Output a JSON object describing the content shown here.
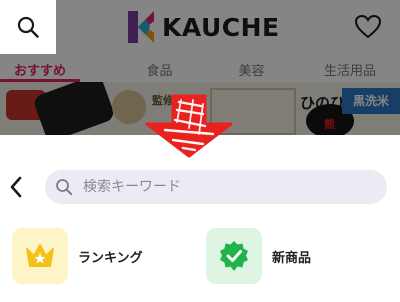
{
  "app": {
    "logo_text": "KAUCHE",
    "category_tabs": [
      {
        "label": "おすすめ",
        "active": true
      },
      {
        "label": "食品",
        "active": false
      },
      {
        "label": "美容",
        "active": false
      },
      {
        "label": "生活用品",
        "active": false
      }
    ],
    "banner": {
      "badge": "熊",
      "tag": "黒洗米",
      "package_text": "ひのひかり",
      "label": "監修"
    }
  },
  "search": {
    "placeholder": "検索キーワード"
  },
  "quick_links": [
    {
      "label": "ランキング",
      "icon": "crown-icon"
    },
    {
      "label": "新商品",
      "icon": "new-badge-icon"
    }
  ],
  "colors": {
    "accent": "#e0245e",
    "overlay_arrow": "#e8231f",
    "search_bg": "#eceaf2",
    "ranking_bg": "#fdf4c8",
    "ranking_icon": "#f4c21b",
    "new_bg": "#dff5e3",
    "new_icon": "#22b24c"
  }
}
